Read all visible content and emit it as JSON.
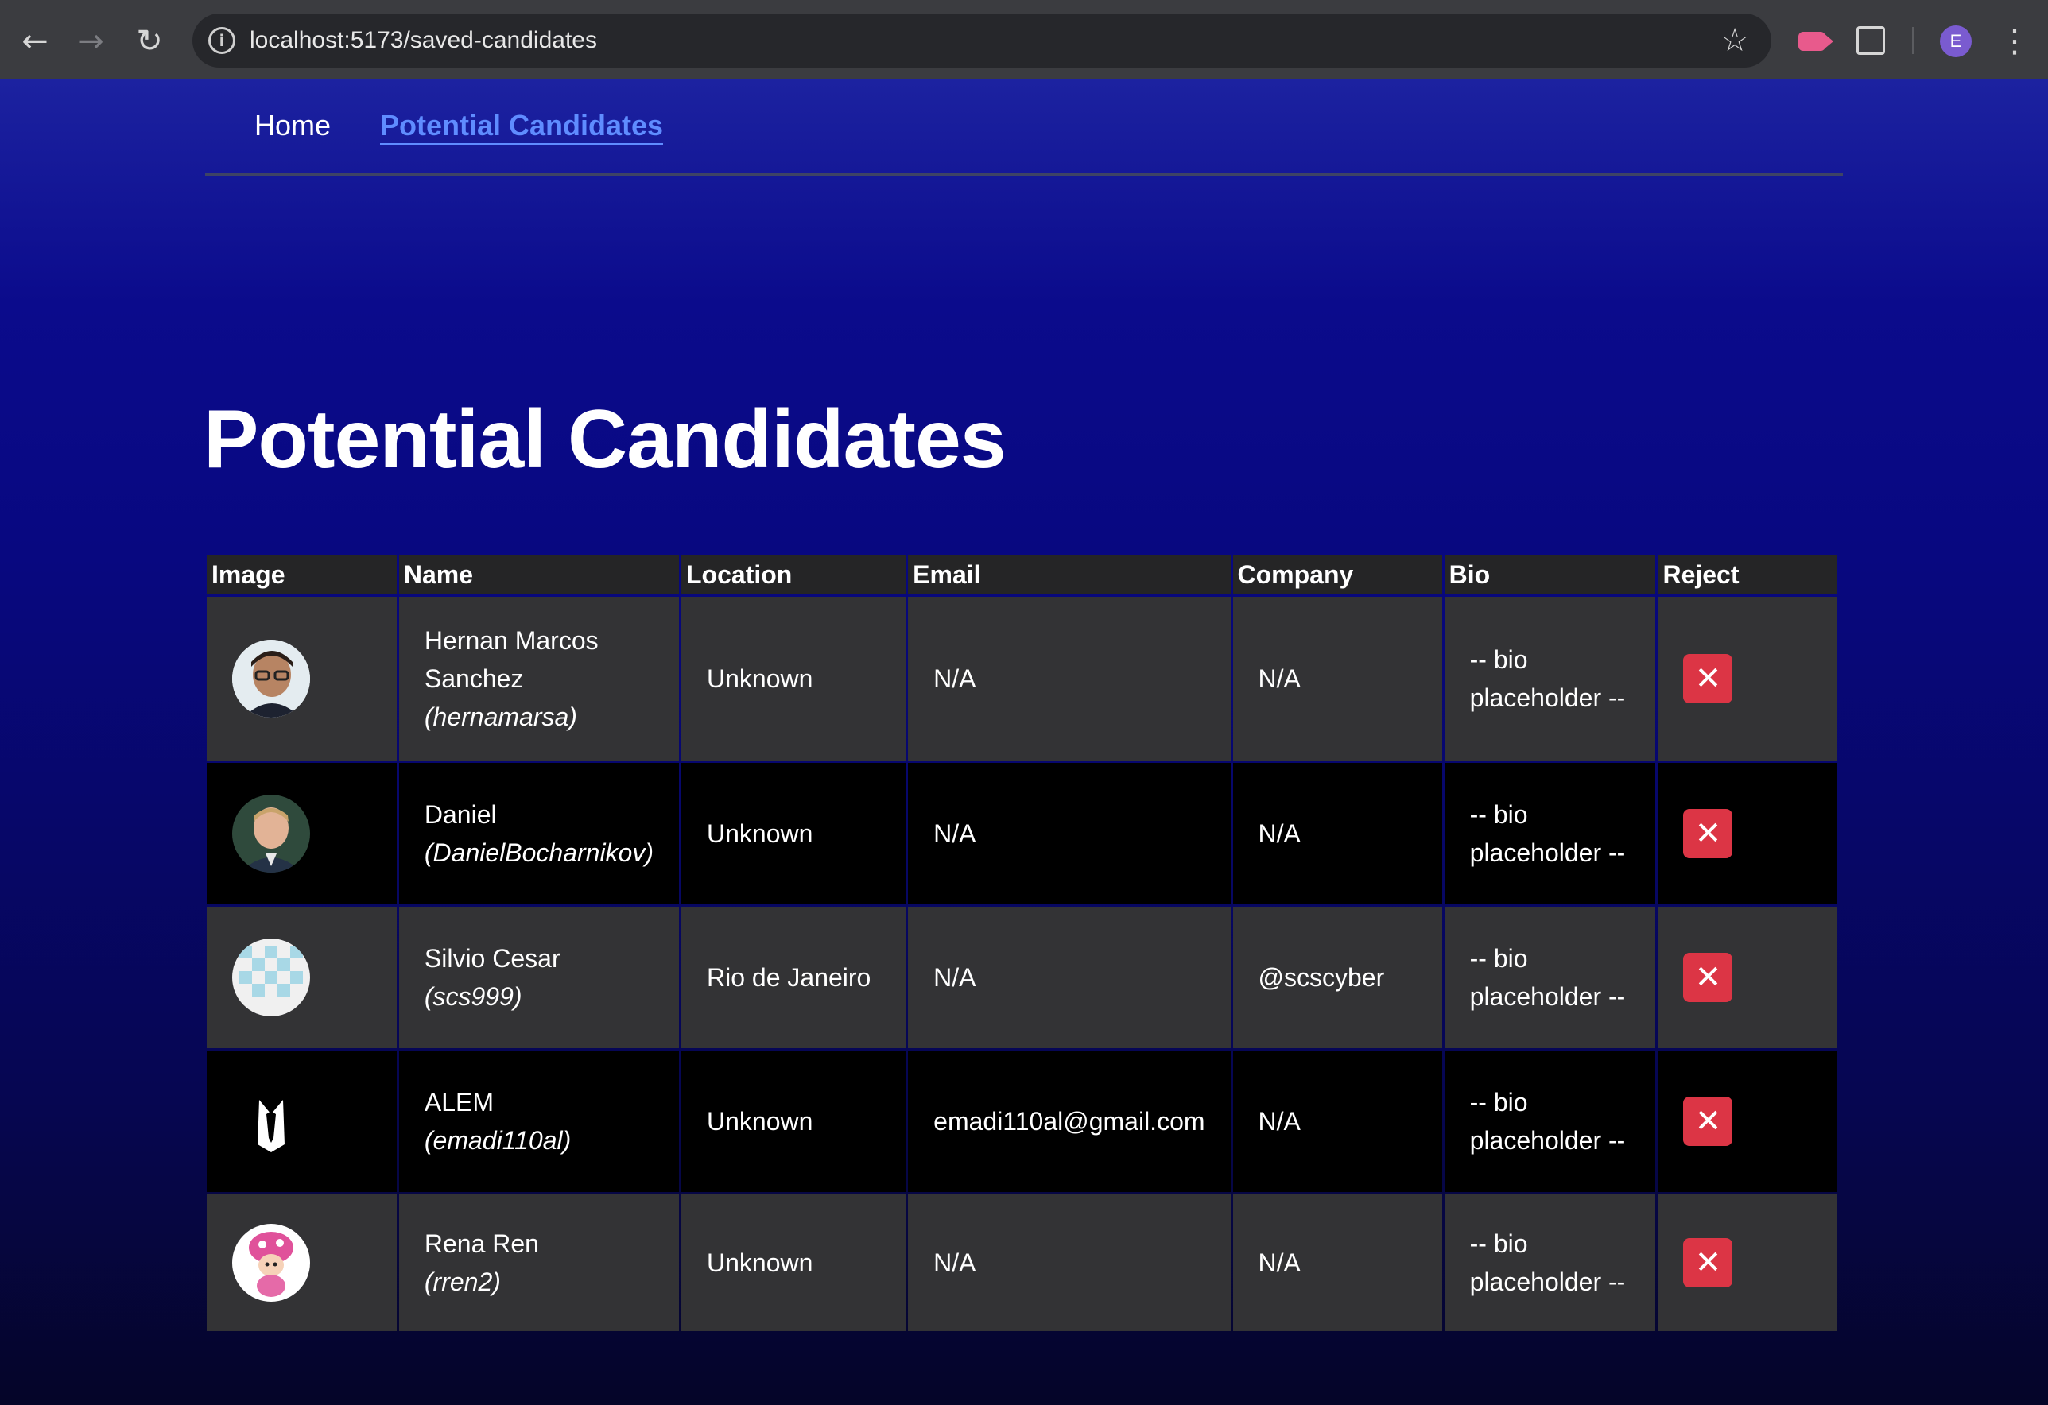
{
  "browser": {
    "url": "localhost:5173/saved-candidates",
    "profile_initial": "E"
  },
  "nav": {
    "home": "Home",
    "potential": "Potential Candidates"
  },
  "page": {
    "title": "Potential Candidates"
  },
  "table": {
    "headers": [
      "Image",
      "Name",
      "Location",
      "Email",
      "Company",
      "Bio",
      "Reject"
    ],
    "rows": [
      {
        "name": "Hernan Marcos Sanchez",
        "login": "(hernamarsa)",
        "location": "Unknown",
        "email": "N/A",
        "company": "N/A",
        "bio": "-- bio placeholder --",
        "avatar": "avatar-photo-glasses"
      },
      {
        "name": "Daniel",
        "login": "(DanielBocharnikov)",
        "location": "Unknown",
        "email": "N/A",
        "company": "N/A",
        "bio": "-- bio placeholder --",
        "avatar": "avatar-photo-man"
      },
      {
        "name": "Silvio Cesar",
        "login": "(scs999)",
        "location": "Rio de Janeiro",
        "email": "N/A",
        "company": "@scscyber",
        "bio": "-- bio placeholder --",
        "avatar": "avatar-identicon"
      },
      {
        "name": "ALEM",
        "login": "(emadi110al)",
        "location": "Unknown",
        "email": "emadi110al@gmail.com",
        "company": "N/A",
        "bio": "-- bio placeholder --",
        "avatar": "avatar-tuxedo"
      },
      {
        "name": "Rena Ren",
        "login": "(rren2)",
        "location": "Unknown",
        "email": "N/A",
        "company": "N/A",
        "bio": "-- bio placeholder --",
        "avatar": "avatar-toadette"
      }
    ]
  },
  "colors": {
    "accent": "#5f8cff",
    "reject": "#dc3545",
    "row_odd": "#333335",
    "row_even": "#000000"
  }
}
